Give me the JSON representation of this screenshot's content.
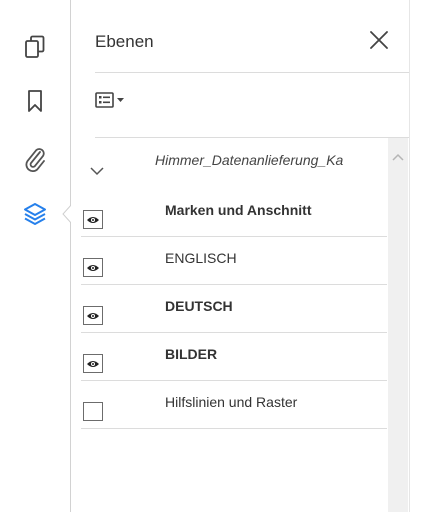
{
  "left_rail": {
    "icons": [
      {
        "name": "pages-icon"
      },
      {
        "name": "bookmark-icon"
      },
      {
        "name": "attachment-icon"
      },
      {
        "name": "layers-icon",
        "active": true,
        "color": "#2680eb"
      }
    ]
  },
  "panel": {
    "title": "Ebenen",
    "root_label": "Himmer_Datenanlieferung_Ka",
    "layers": [
      {
        "label": "Marken und Anschnitt",
        "bold": true,
        "visible": true
      },
      {
        "label": "ENGLISCH",
        "bold": false,
        "visible": true
      },
      {
        "label": "DEUTSCH",
        "bold": true,
        "visible": true
      },
      {
        "label": "BILDER",
        "bold": true,
        "visible": true
      },
      {
        "label": "Hilfslinien und Raster",
        "bold": false,
        "visible": false
      }
    ]
  }
}
